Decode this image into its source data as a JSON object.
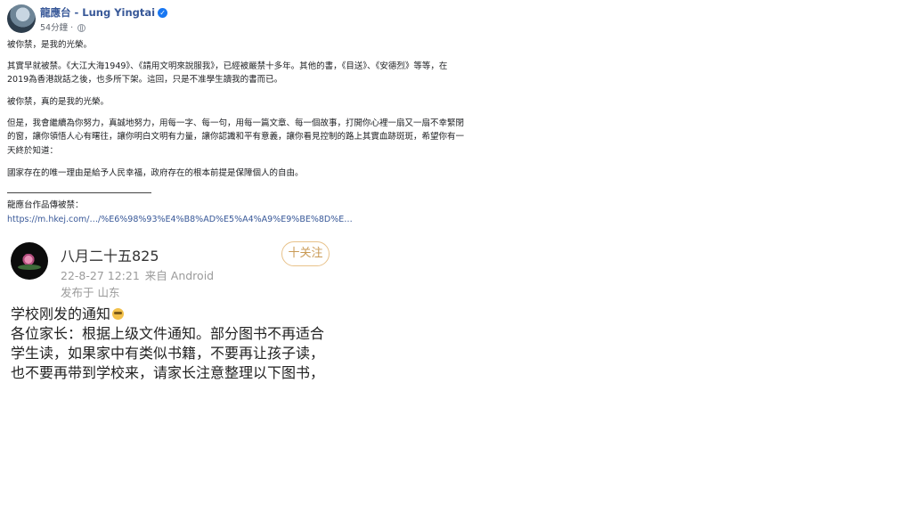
{
  "facebook_post": {
    "author": "龍應台 - Lung Yingtai",
    "timestamp": "54分鐘",
    "meta_separator": "·",
    "paragraphs": [
      "被你禁，是我的光榮。",
      "其實早就被禁。《大江大海1949》、《請用文明來說服我》，已經被嚴禁十多年。其他的書，《目送》、《安德烈》等等，在2019為香港說話之後，也多所下架。這回，只是不准學生讀我的書而已。",
      "被你禁，真的是我的光榮。",
      "但是，我會繼續為你努力，真誠地努力，用每一字、每一句，用每一篇文章、每一個故事，打開你心裡一扇又一扇不幸緊閉的窗，讓你領悟人心有曙往，讓你明白文明有力量，讓你認識和平有意義，讓你看見控制的路上其實血跡斑斑，希望你有一天終於知道：",
      "國家存在的唯一理由是給予人民幸福，政府存在的根本前提是保障個人的自由。"
    ],
    "footer_label": "龍應台作品傳被禁：",
    "link": "https://m.hkej.com/…/%E6%98%93%E4%B8%AD%E5%A4%A9%E9%BE%8D%E…"
  },
  "weibo_post": {
    "username": "八月二十五825",
    "time": "22-8-27 12:21",
    "source": "来自 Android",
    "location": "发布于 山东",
    "follow_label": "十关注",
    "lines": [
      "学校刚发的通知",
      "各位家长：根据上级文件通知。部分图书不再适合",
      "学生读，如果家中有类似书籍，不要再让孩子读，",
      "也不要再带到学校来，请家长注意整理以下图书，"
    ]
  },
  "icons": {
    "verified": "verified-badge-icon",
    "privacy": "globe-icon",
    "emoji": "embarrassed-emoji-icon",
    "avatar_art": "lotus-icon"
  },
  "colors": {
    "facebook_link": "#385898",
    "follow_button": "#c99a55"
  }
}
